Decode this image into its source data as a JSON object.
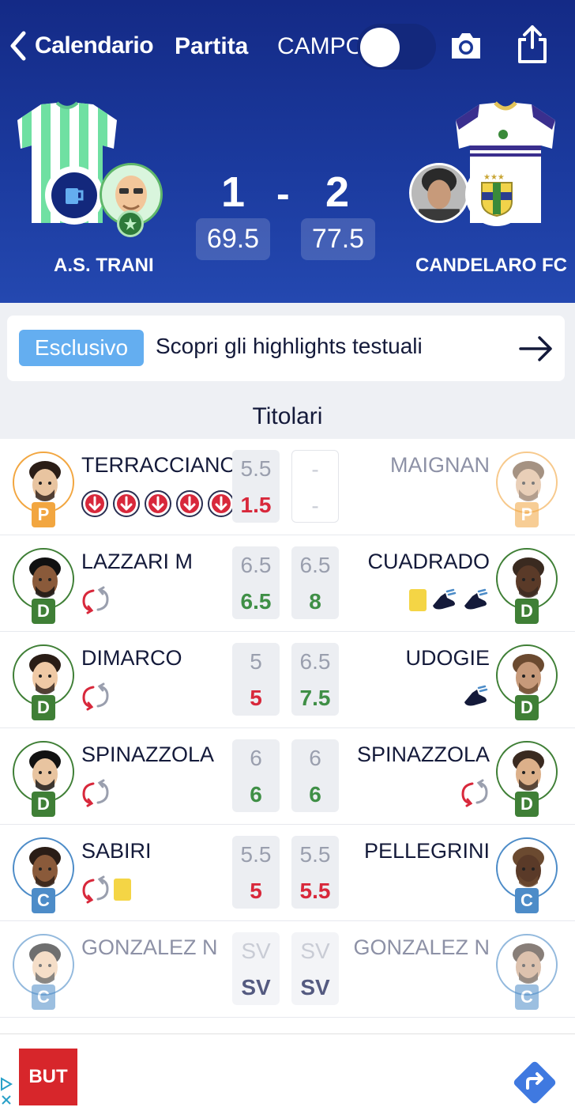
{
  "nav": {
    "back_label": "Calendario",
    "title": "Partita",
    "field_label": "CAMPO",
    "field_toggle_on": false
  },
  "match": {
    "home": {
      "name": "A.S. TRANI",
      "goals": "1",
      "points": "69.5"
    },
    "away": {
      "name": "CANDELARO FC",
      "goals": "2",
      "points": "77.5"
    },
    "separator": "-"
  },
  "banner": {
    "badge": "Esclusivo",
    "text": "Scopri gli highlights testuali"
  },
  "section_title": "Titolari",
  "rows": [
    {
      "left": {
        "name": "TERRACCIANO",
        "role": "P",
        "vote": "5.5",
        "fv": "1.5",
        "fv_color": "red",
        "icons": [
          "goal-conceded",
          "goal-conceded",
          "goal-conceded",
          "goal-conceded",
          "goal-conceded"
        ]
      },
      "right": {
        "name": "MAIGNAN",
        "role": "P",
        "vote": "-",
        "fv": "-",
        "fv_color": "grey",
        "icons": [],
        "faded": true
      }
    },
    {
      "left": {
        "name": "LAZZARI M",
        "role": "D",
        "vote": "6.5",
        "fv": "6.5",
        "fv_color": "green",
        "icons": [
          "substitution"
        ]
      },
      "right": {
        "name": "CUADRADO",
        "role": "D",
        "vote": "6.5",
        "fv": "8",
        "fv_color": "green",
        "icons": [
          "yellow-card",
          "assist",
          "assist"
        ]
      }
    },
    {
      "left": {
        "name": "DIMARCO",
        "role": "D",
        "vote": "5",
        "fv": "5",
        "fv_color": "red",
        "icons": [
          "substitution"
        ]
      },
      "right": {
        "name": "UDOGIE",
        "role": "D",
        "vote": "6.5",
        "fv": "7.5",
        "fv_color": "green",
        "icons": [
          "assist"
        ]
      }
    },
    {
      "left": {
        "name": "SPINAZZOLA",
        "role": "D",
        "vote": "6",
        "fv": "6",
        "fv_color": "green",
        "icons": [
          "substitution"
        ]
      },
      "right": {
        "name": "SPINAZZOLA",
        "role": "D",
        "vote": "6",
        "fv": "6",
        "fv_color": "green",
        "icons": [
          "substitution"
        ]
      }
    },
    {
      "left": {
        "name": "SABIRI",
        "role": "C",
        "vote": "5.5",
        "fv": "5",
        "fv_color": "red",
        "icons": [
          "substitution",
          "yellow-card"
        ]
      },
      "right": {
        "name": "PELLEGRINI",
        "role": "C",
        "vote": "5.5",
        "fv": "5.5",
        "fv_color": "red",
        "icons": []
      }
    },
    {
      "left": {
        "name": "GONZALEZ N",
        "role": "C",
        "vote": "SV",
        "fv": "SV",
        "fv_color": "navy",
        "icons": [],
        "faded": true
      },
      "right": {
        "name": "GONZALEZ N",
        "role": "C",
        "vote": "SV",
        "fv": "SV",
        "fv_color": "navy",
        "icons": [],
        "faded": true
      }
    }
  ],
  "colors": {
    "header": "#1b3a9e",
    "green": "#3f8f46",
    "red": "#d8283b",
    "navy": "#2a2f52",
    "grey": "#b5b9c4",
    "role_P": "#f2a640",
    "role_D": "#3f7f36",
    "role_C": "#4d8cc8",
    "badge_blue": "#64aef0"
  },
  "ad": {
    "brand": "BUT"
  }
}
